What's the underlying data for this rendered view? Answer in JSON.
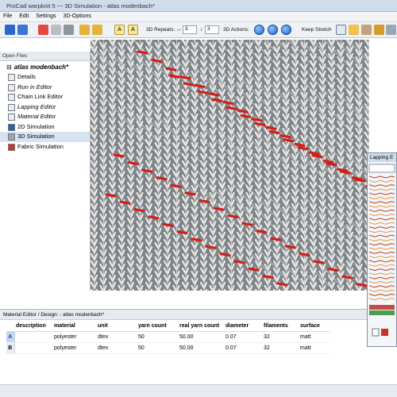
{
  "window": {
    "title": "ProCad warpknit 5 --- 3D Simulation - atlas modenbach*"
  },
  "menu": [
    "File",
    "Edit",
    "Settings",
    "3D-Options"
  ],
  "toolbar": {
    "repeats_label": "3D Repeats:",
    "repeat_x": "3",
    "repeat_y": "3",
    "actions_label": "3D Actions:",
    "keep_stretch_label": "Keep Stretch"
  },
  "open_files": {
    "header": "Open Files",
    "root": "atlas modenbach*",
    "items": [
      {
        "label": "Details",
        "icon": "details-icon"
      },
      {
        "label": "Run in Editor",
        "icon": "run-in-editor-icon"
      },
      {
        "label": "Chain Link Editor",
        "icon": "chain-link-icon"
      },
      {
        "label": "Lapping Editor",
        "icon": "lapping-editor-icon"
      },
      {
        "label": "Material Editor",
        "icon": "material-editor-icon"
      },
      {
        "label": "2D Simulation",
        "icon": "2d-simulation-icon"
      },
      {
        "label": "3D Simulation",
        "icon": "3d-simulation-icon",
        "selected": true
      },
      {
        "label": "Fabric Simulation",
        "icon": "fabric-simulation-icon"
      }
    ]
  },
  "lapping_window": {
    "title": "Lapping E"
  },
  "material_editor": {
    "title": "Material Editor / Design: - atlas modenbach*",
    "columns": [
      "description",
      "material",
      "unit",
      "yarn count",
      "real yarn count",
      "diameter",
      "filaments",
      "surface"
    ],
    "rows": [
      {
        "id": "A",
        "description": "",
        "material": "polyester",
        "unit": "dtex",
        "yarn_count": "50",
        "real_yarn_count": "50.00",
        "diameter": "0.07",
        "filaments": "32",
        "surface": "matt"
      },
      {
        "id": "B",
        "description": "",
        "material": "polyester",
        "unit": "dtex",
        "yarn_count": "50",
        "real_yarn_count": "50.00",
        "diameter": "0.07",
        "filaments": "32",
        "surface": "matt"
      }
    ]
  },
  "colors": {
    "accent_red": "#d21f1a",
    "fabric_bg": "#7f8487",
    "yarn": "#ececec",
    "title_blue": "#cfdceb"
  }
}
